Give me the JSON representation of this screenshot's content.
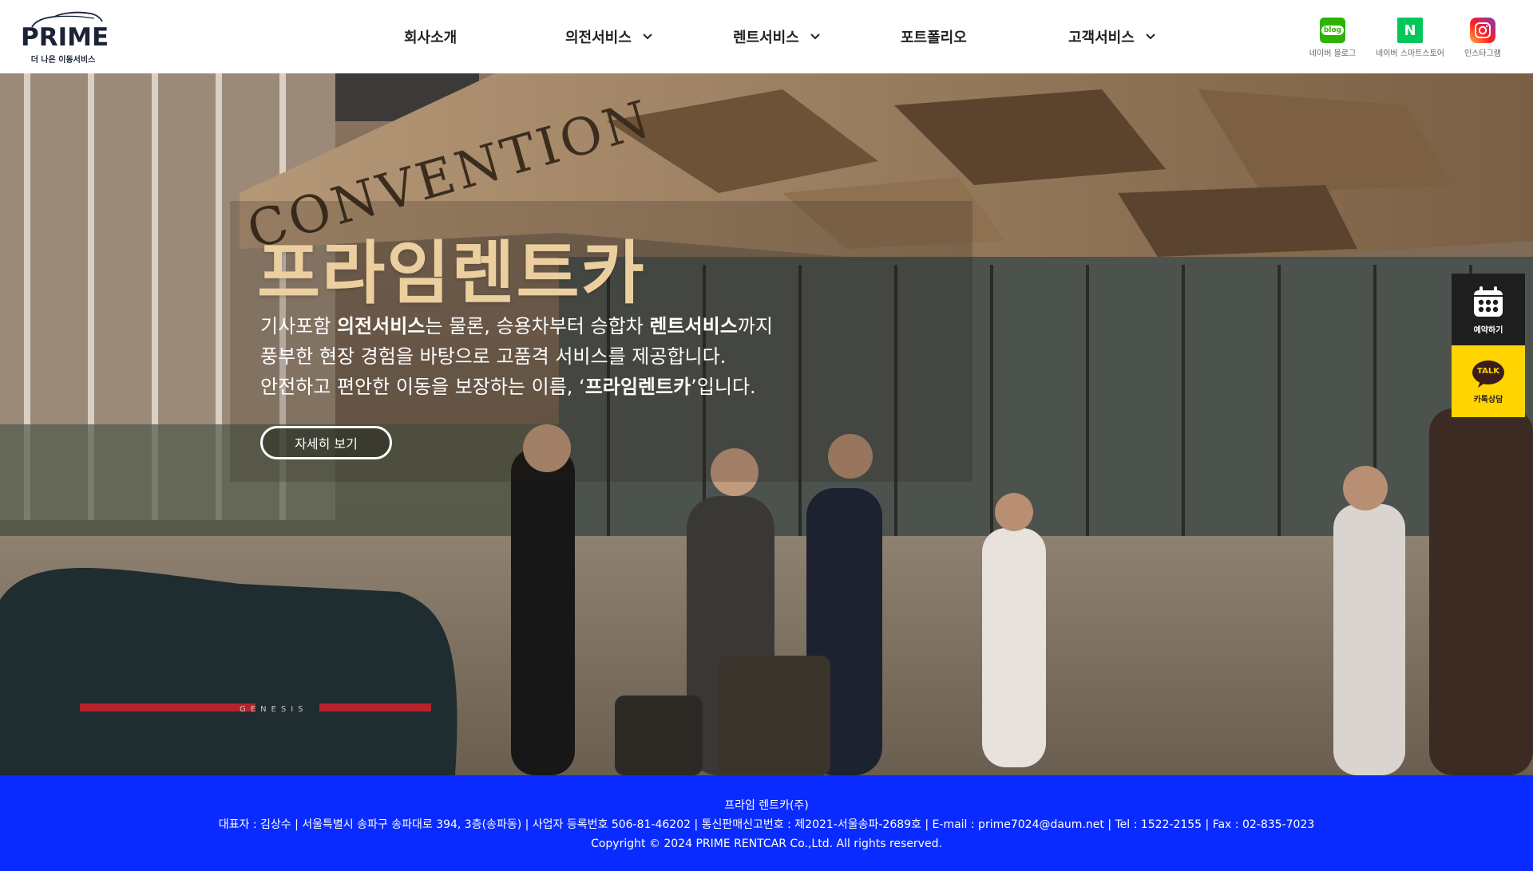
{
  "header": {
    "logo": {
      "wordmark": "PRIME",
      "tagline": "더 나은 이동서비스"
    },
    "nav": [
      {
        "label": "회사소개",
        "has_dropdown": false
      },
      {
        "label": "의전서비스",
        "has_dropdown": true
      },
      {
        "label": "렌트서비스",
        "has_dropdown": true
      },
      {
        "label": "포트폴리오",
        "has_dropdown": false
      },
      {
        "label": "고객서비스",
        "has_dropdown": true
      }
    ],
    "social": [
      {
        "label": "네이버 블로그",
        "icon": "blog-icon",
        "icon_text": "blog",
        "color": "#2db400"
      },
      {
        "label": "네이버 스마트스토어",
        "icon": "naver-icon",
        "icon_text": "N",
        "color": "#03c75a"
      },
      {
        "label": "인스타그램",
        "icon": "instagram-icon",
        "color": "#d6249f"
      }
    ]
  },
  "hero": {
    "title": "프라임렌트카",
    "line1": {
      "a": "기사포함 ",
      "b": "의전서비스",
      "c": "는 물론, 승용차부터 승합차 ",
      "d": "렌트서비스",
      "e": "까지"
    },
    "line2": "풍부한 현장 경험을 바탕으로 고품격 서비스를 제공합니다.",
    "line3": {
      "a": "안전하고 편안한 이동을 보장하는 이름, ‘",
      "b": "프라임렌트카",
      "c": "’입니다."
    },
    "button_label": "자세히 보기",
    "sign_text": "CONVENTION",
    "car_badge": "GENESIS"
  },
  "side_buttons": {
    "reserve": {
      "label": "예약하기",
      "icon": "calendar-icon"
    },
    "talk": {
      "label": "카톡상담",
      "icon": "kakaotalk-icon",
      "icon_text": "TALK"
    }
  },
  "footer": {
    "company": "프라임 렌트카(주)",
    "info": "대표자 : 김상수 | 서울특별시 송파구 송파대로 394, 3층(송파동) | 사업자 등록번호 506-81-46202 | 통신판매신고번호 : 제2021-서울송파-2689호 | E-mail : prime7024@daum.net | Tel : 1522-2155 | Fax : 02-835-7023",
    "copyright": "Copyright © 2024 PRIME RENTCAR Co.,Ltd. All rights reserved."
  },
  "colors": {
    "footer_bg": "#0a2bff",
    "title_gold": "#ebcf9f",
    "talk_yellow": "#ffd400",
    "reserve_dark": "#1e1e1e"
  }
}
